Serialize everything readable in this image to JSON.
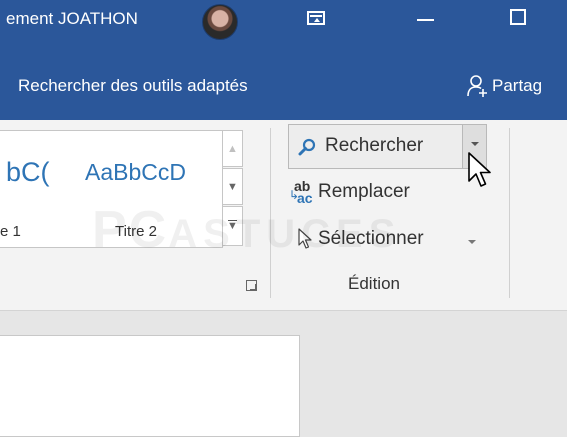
{
  "titlebar": {
    "user_name": "ement JOATHON",
    "background": "#2b579a"
  },
  "tellbar": {
    "search_prompt": "Rechercher des outils adaptés",
    "share_label": "Partag"
  },
  "styles": {
    "items": [
      {
        "sample": "bC(",
        "label": "e 1"
      },
      {
        "sample": "AaBbCcD",
        "label": "Titre 2"
      }
    ]
  },
  "editing": {
    "find_label": "Rechercher",
    "replace_label": "Remplacer",
    "select_label": "Sélectionner",
    "group_label": "Édition"
  },
  "watermark": {
    "big": "PC",
    "small": "ASTUCES"
  },
  "colors": {
    "ribbon_blue": "#2b579a",
    "style_blue": "#2e74b5",
    "ribbon_bg": "#f3f3f3"
  },
  "icons": {
    "find": "magnifier-icon",
    "replace": "replace-ab-ac-icon",
    "select": "pointer-arrow-icon",
    "share": "person-add-icon",
    "ribbon_display": "ribbon-display-options-icon",
    "minimize": "minimize-icon",
    "maximize": "maximize-icon"
  }
}
